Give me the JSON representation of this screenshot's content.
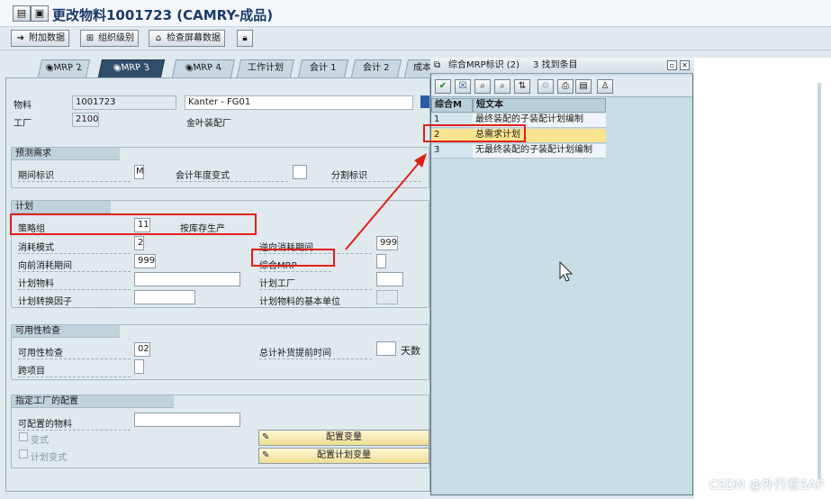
{
  "window": {
    "title": "更改物料1001723 (CAMRY-成品)"
  },
  "toolbar": {
    "buttons": [
      {
        "label": "附加数据",
        "icon": "arrow-right-icon"
      },
      {
        "label": "组织级别",
        "icon": "org-levels-icon"
      },
      {
        "label": "检查屏幕数据",
        "icon": "check-screen-icon"
      }
    ]
  },
  "tabs": [
    {
      "label": "MRP 2",
      "active": false
    },
    {
      "label": "MRP 3",
      "active": true
    },
    {
      "label": "MRP 4",
      "active": false
    },
    {
      "label": "工作计划",
      "active": false
    },
    {
      "label": "会计 1",
      "active": false
    },
    {
      "label": "会计 2",
      "active": false
    },
    {
      "label": "成本",
      "active": false
    }
  ],
  "header": {
    "material_label": "物料",
    "material_value": "1001723",
    "material_desc": "Kanter - FG01",
    "plant_label": "工厂",
    "plant_value": "2100",
    "plant_desc": "金叶装配厂"
  },
  "forecast": {
    "title": "预测需求",
    "period_label": "期间标识",
    "period_value": "M",
    "fiscal_label": "会计年度变式",
    "fiscal_value": "",
    "split_label": "分割标识"
  },
  "planning": {
    "title": "计划",
    "strategy_label": "策略组",
    "strategy_value": "11",
    "strategy_desc": "按库存生产",
    "consumption_label": "消耗模式",
    "consumption_value": "2",
    "backward_label": "逆向消耗期间",
    "backward_value": "999",
    "forward_label": "向前消耗期间",
    "forward_value": "999",
    "mixed_mrp_label": "综合MRP",
    "mixed_mrp_value": "",
    "plan_material_label": "计划物料",
    "plan_material_value": "",
    "plan_plant_label": "计划工厂",
    "plan_plant_value": "",
    "conv_factor_label": "计划转换因子",
    "conv_factor_value": "",
    "base_unit_label": "计划物料的基本单位",
    "base_unit_value": ""
  },
  "availability": {
    "title": "可用性检查",
    "check_label": "可用性检查",
    "check_value": "02",
    "total_lead_label": "总计补货提前时间",
    "total_lead_value": "",
    "days_label": "天数",
    "cross_project_label": "跨项目",
    "cross_project_value": ""
  },
  "plant_config": {
    "title": "指定工厂的配置",
    "configurable_label": "可配置的物料",
    "configurable_value": "",
    "variant_label": "变式",
    "plan_variant_label": "计划变式",
    "config_variant_btn": "配置变量",
    "config_plan_variant_btn": "配置计划变量"
  },
  "popup": {
    "title": "综合MRP标识 (2)",
    "hits": "3 找到条目",
    "columns": [
      "综合M",
      "短文本"
    ],
    "rows": [
      {
        "code": "1",
        "text": "最终装配的子装配计划编制",
        "selected": false
      },
      {
        "code": "2",
        "text": "总需求计划",
        "selected": true
      },
      {
        "code": "3",
        "text": "无最终装配的子装配计划编制",
        "selected": false
      }
    ]
  },
  "watermark": "CSDN @外行看SAP"
}
